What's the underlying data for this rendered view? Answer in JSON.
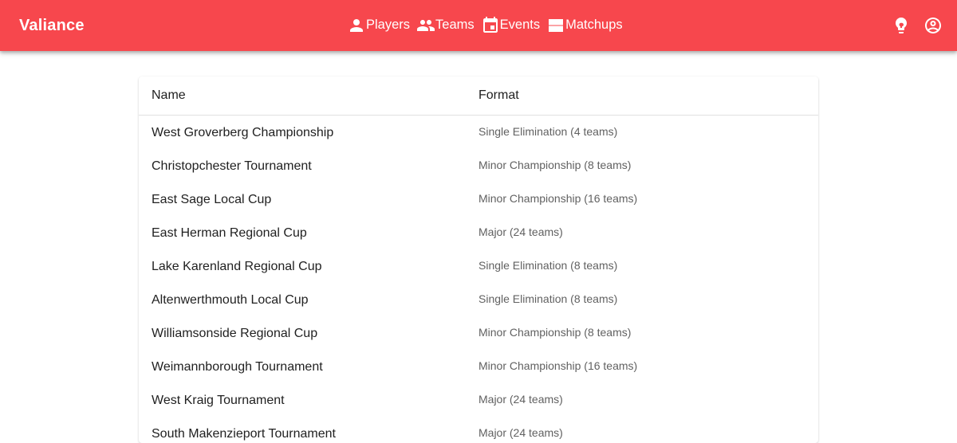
{
  "header": {
    "brand": "Valiance",
    "nav": [
      {
        "label": "Players",
        "icon": "person-icon"
      },
      {
        "label": "Teams",
        "icon": "people-icon"
      },
      {
        "label": "Events",
        "icon": "calendar-icon"
      },
      {
        "label": "Matchups",
        "icon": "matchups-icon"
      }
    ],
    "actions": [
      {
        "icon": "lightbulb-icon"
      },
      {
        "icon": "account-circle-icon"
      }
    ],
    "color": "#f7474d"
  },
  "table": {
    "columns": [
      "Name",
      "Format"
    ],
    "rows": [
      {
        "name": "West Groverberg Championship",
        "format": "Single Elimination (4 teams)"
      },
      {
        "name": "Christopchester Tournament",
        "format": "Minor Championship (8 teams)"
      },
      {
        "name": "East Sage Local Cup",
        "format": "Minor Championship (16 teams)"
      },
      {
        "name": "East Herman Regional Cup",
        "format": "Major (24 teams)"
      },
      {
        "name": "Lake Karenland Regional Cup",
        "format": "Single Elimination (8 teams)"
      },
      {
        "name": "Altenwerthmouth Local Cup",
        "format": "Single Elimination (8 teams)"
      },
      {
        "name": "Williamsonside Regional Cup",
        "format": "Minor Championship (8 teams)"
      },
      {
        "name": "Weimannborough Tournament",
        "format": "Minor Championship (16 teams)"
      },
      {
        "name": "West Kraig Tournament",
        "format": "Major (24 teams)"
      },
      {
        "name": "South Makenzieport Tournament",
        "format": "Major (24 teams)"
      }
    ]
  }
}
